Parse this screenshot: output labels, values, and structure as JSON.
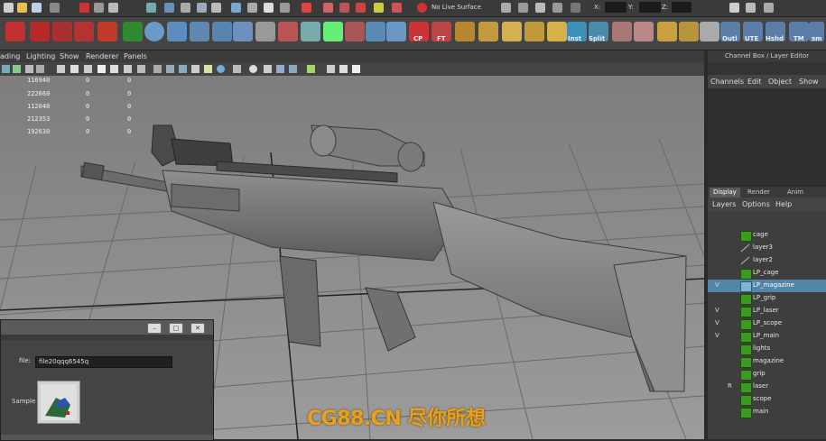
{
  "status_line": {
    "live_surface_label": "No Live Surface",
    "coord_x_label": "X:",
    "coord_y_label": "Y:",
    "coord_z_label": "Z:"
  },
  "shelf": {
    "labels": [
      "CP",
      "FT",
      "Inst",
      "Split",
      "Outl",
      "UTE",
      "Hshd",
      "TM",
      "sm"
    ]
  },
  "viewport": {
    "menus": [
      "ading",
      "Lighting",
      "Show",
      "Renderer",
      "Panels"
    ],
    "hud": [
      {
        "a": "116940",
        "b": "0",
        "c": "0"
      },
      {
        "a": "222660",
        "b": "0",
        "c": "0"
      },
      {
        "a": "112040",
        "b": "0",
        "c": "0"
      },
      {
        "a": "212353",
        "b": "0",
        "c": "0"
      },
      {
        "a": "192630",
        "b": "0",
        "c": "0"
      }
    ]
  },
  "channel_box": {
    "title": "Channel Box / Layer Editor",
    "menus": [
      "Channels",
      "Edit",
      "Object",
      "Show"
    ]
  },
  "layer_editor": {
    "tabs": [
      "Display",
      "Render",
      "Anim"
    ],
    "active_tab": "Display",
    "menus": [
      "Layers",
      "Options",
      "Help"
    ],
    "layers": [
      {
        "v": "",
        "r": "",
        "name": "cage",
        "type": "color"
      },
      {
        "v": "",
        "r": "",
        "name": "layer3",
        "type": "slash"
      },
      {
        "v": "",
        "r": "",
        "name": "layer2",
        "type": "slash"
      },
      {
        "v": "",
        "r": "",
        "name": "LP_cage",
        "type": "color"
      },
      {
        "v": "V",
        "r": "",
        "name": "LP_magazine",
        "type": "color"
      },
      {
        "v": "",
        "r": "",
        "name": "LP_grip",
        "type": "color"
      },
      {
        "v": "V",
        "r": "",
        "name": "LP_laser",
        "type": "color"
      },
      {
        "v": "V",
        "r": "",
        "name": "LP_scope",
        "type": "color"
      },
      {
        "v": "V",
        "r": "",
        "name": "LP_main",
        "type": "color"
      },
      {
        "v": "",
        "r": "",
        "name": "lights",
        "type": "color"
      },
      {
        "v": "",
        "r": "",
        "name": "magazine",
        "type": "color"
      },
      {
        "v": "",
        "r": "",
        "name": "grip",
        "type": "color"
      },
      {
        "v": "",
        "r": "R",
        "name": "laser",
        "type": "color"
      },
      {
        "v": "",
        "r": "",
        "name": "scope",
        "type": "color"
      },
      {
        "v": "",
        "r": "",
        "name": "main",
        "type": "color"
      }
    ],
    "selected_layer": "LP_magazine"
  },
  "dialog": {
    "file_label": "file:",
    "file_value": "file20qqq6545q",
    "sample_label": "Sample"
  },
  "watermark": "CG88.CN 尽你所想",
  "colors": {
    "layer_green": "#3c9a1f",
    "selection_blue": "#5285a6",
    "watermark_orange": "#e8a11a"
  }
}
